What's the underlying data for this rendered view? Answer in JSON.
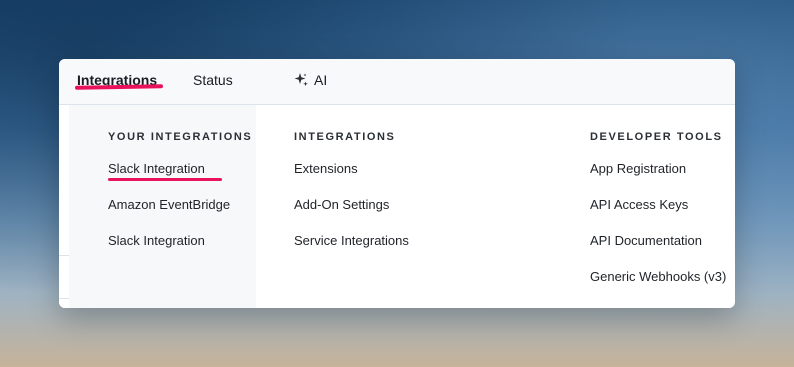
{
  "nav": {
    "integrations": "Integrations",
    "status": "Status",
    "ai": "AI",
    "ai_icon": "sparkle-icon"
  },
  "columns": [
    {
      "title": "YOUR INTEGRATIONS",
      "items": [
        "Slack Integration",
        "Amazon EventBridge",
        "Slack Integration"
      ]
    },
    {
      "title": "INTEGRATIONS",
      "items": [
        "Extensions",
        "Add-On Settings",
        "Service Integrations"
      ]
    },
    {
      "title": "DEVELOPER TOOLS",
      "items": [
        "App Registration",
        "API Access Keys",
        "API Documentation",
        "Generic Webhooks (v3)"
      ]
    }
  ],
  "colors": {
    "highlight_underline": "#e8135a"
  }
}
